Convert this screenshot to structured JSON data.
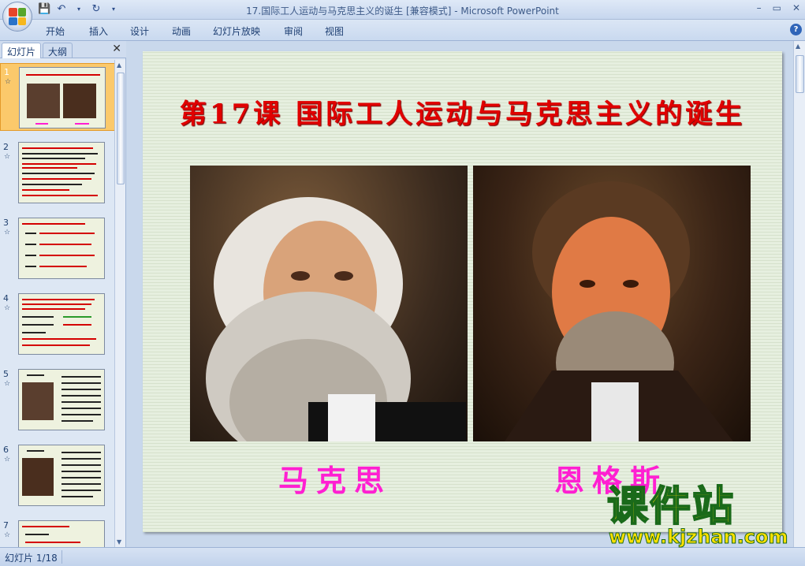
{
  "window": {
    "title": "17.国际工人运动与马克思主义的诞生 [兼容模式] - Microsoft PowerPoint",
    "controls": [
      "–",
      "▭",
      "✕"
    ]
  },
  "quick_access": {
    "icons": [
      "save-icon",
      "undo-icon",
      "redo-icon",
      "customize-icon"
    ]
  },
  "ribbon": {
    "tabs": [
      "开始",
      "插入",
      "设计",
      "动画",
      "幻灯片放映",
      "审阅",
      "视图"
    ],
    "help": "?"
  },
  "left_panel": {
    "tabs": [
      "幻灯片",
      "大纲"
    ],
    "close": "✕",
    "thumbnails": [
      {
        "num": "1",
        "selected": true
      },
      {
        "num": "2",
        "selected": false
      },
      {
        "num": "3",
        "selected": false
      },
      {
        "num": "4",
        "selected": false
      },
      {
        "num": "5",
        "selected": false
      },
      {
        "num": "6",
        "selected": false
      },
      {
        "num": "7",
        "selected": false
      }
    ],
    "anim_marker": "☆"
  },
  "slide": {
    "title": "第17课 国际工人运动与马克思主义的诞生",
    "caption_left": "马克思",
    "caption_right": "恩格斯"
  },
  "watermark": {
    "big": "课件站",
    "small": "www.kjzhan.com"
  },
  "status": {
    "slide_indicator": "幻灯片 1/18"
  },
  "colors": {
    "title_red": "#e00000",
    "caption_magenta": "#ff1fd2",
    "selected_thumb": "#fbc96b",
    "watermark_yellow": "#ffe000"
  }
}
